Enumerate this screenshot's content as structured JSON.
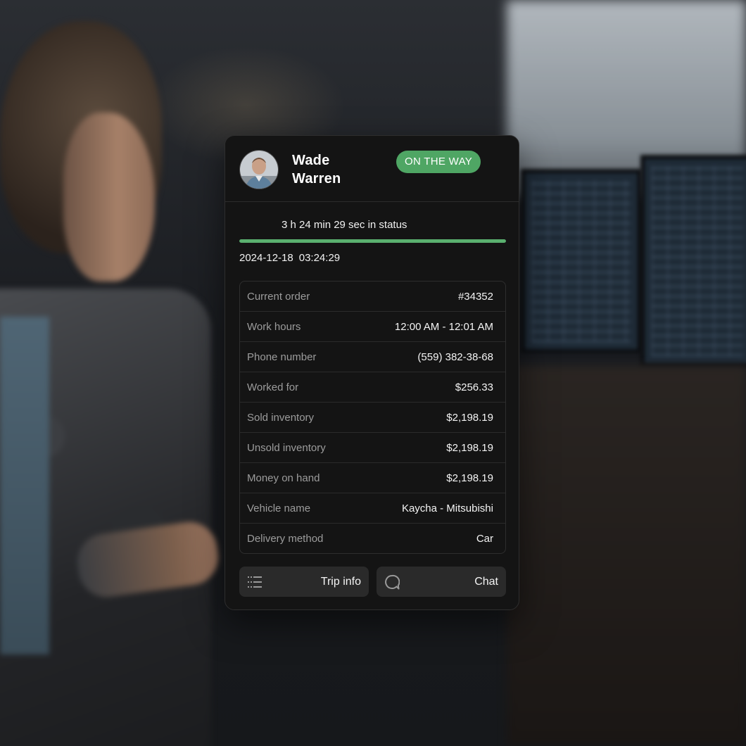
{
  "driver": {
    "name": "Wade Warren",
    "status": "ON THE WAY"
  },
  "status_timer": {
    "elapsed_text": "3 h 24 min 29 sec in status",
    "progress": 1.0,
    "date": "2024-12-18",
    "time": "03:24:29"
  },
  "details": [
    {
      "label": "Current order",
      "value": "#34352"
    },
    {
      "label": "Work hours",
      "value": "12:00 AM - 12:01 AM"
    },
    {
      "label": "Phone number",
      "value": "(559) 382-38-68"
    },
    {
      "label": "Worked for",
      "value": "$256.33"
    },
    {
      "label": "Sold inventory",
      "value": "$2,198.19"
    },
    {
      "label": "Unsold inventory",
      "value": "$2,198.19"
    },
    {
      "label": "Money on hand",
      "value": "$2,198.19"
    },
    {
      "label": "Vehicle name",
      "value": "Kaycha - Mitsubishi"
    },
    {
      "label": "Delivery method",
      "value": "Car"
    }
  ],
  "actions": {
    "trip_info": {
      "label": "Trip info",
      "icon": "list-icon"
    },
    "chat": {
      "label": "Chat",
      "icon": "chat-bubble-icon"
    }
  },
  "colors": {
    "accent": "#4fa664",
    "card_bg": "#141414",
    "button_bg": "#2a2a2a"
  }
}
